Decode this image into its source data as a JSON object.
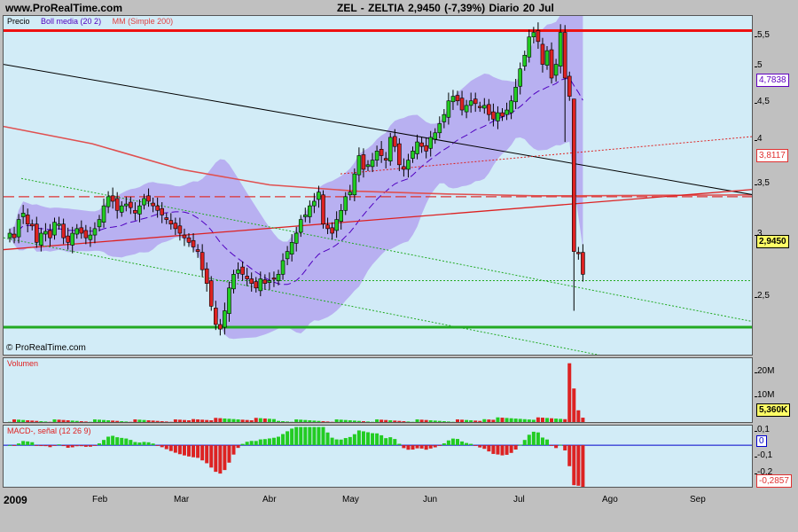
{
  "header": {
    "site": "www.ProRealTime.com",
    "title": "ZEL - ZELTIA    2,9450 (-7,39%)    Diario  20 Jul"
  },
  "price_panel": {
    "legend": {
      "price": "Precio",
      "boll": "Boll media (20 2)",
      "mm": "MM (Simple 200)"
    },
    "copyright": "© ProRealTime.com",
    "ticks": [
      "5,5",
      "5",
      "4,5",
      "4",
      "3,5",
      "3",
      "2,5"
    ],
    "badges": {
      "boll": "4,7838",
      "mm": "3,8117",
      "last": "2,9450"
    }
  },
  "volume_panel": {
    "label": "Volumen",
    "ticks": [
      "20M",
      "10M"
    ],
    "badge": "5,360K"
  },
  "macd_panel": {
    "label": "MACD-, señal (12 26 9)",
    "ticks": [
      "0,1",
      "0",
      "-0,1",
      "-0,2"
    ],
    "badge": "-0,2857"
  },
  "xaxis": {
    "labels": [
      "2009",
      "Feb",
      "Mar",
      "Abr",
      "May",
      "Jun",
      "Jul",
      "Ago",
      "Sep"
    ]
  },
  "colors": {
    "up": "#22cc22",
    "down": "#dd2222",
    "boll_band": "#b4a6f0",
    "boll_mid": "#5000c0",
    "mm200": "#e05050"
  },
  "chart_data": {
    "type": "candlestick",
    "title": "ZEL - ZELTIA",
    "price_ylim": [
      2.05,
      5.78
    ],
    "closes": [
      3.4,
      3.35,
      3.55,
      3.62,
      3.5,
      3.48,
      3.3,
      3.4,
      3.42,
      3.35,
      3.52,
      3.5,
      3.35,
      3.3,
      3.4,
      3.45,
      3.4,
      3.35,
      3.38,
      3.45,
      3.55,
      3.7,
      3.8,
      3.75,
      3.65,
      3.7,
      3.72,
      3.68,
      3.62,
      3.7,
      3.78,
      3.75,
      3.7,
      3.65,
      3.6,
      3.55,
      3.5,
      3.45,
      3.4,
      3.35,
      3.3,
      3.25,
      3.2,
      3.0,
      2.85,
      2.6,
      2.4,
      2.35,
      2.55,
      2.8,
      2.95,
      3.0,
      2.95,
      2.9,
      2.85,
      2.8,
      2.9,
      2.85,
      2.88,
      2.9,
      2.95,
      3.1,
      3.2,
      3.3,
      3.4,
      3.55,
      3.6,
      3.7,
      3.75,
      3.85,
      3.5,
      3.45,
      3.4,
      3.55,
      3.65,
      3.8,
      3.85,
      4.05,
      4.25,
      4.1,
      4.15,
      4.2,
      4.3,
      4.25,
      4.2,
      4.45,
      4.35,
      4.15,
      4.1,
      4.2,
      4.3,
      4.4,
      4.35,
      4.3,
      4.45,
      4.5,
      4.6,
      4.7,
      4.85,
      4.9,
      4.85,
      4.75,
      4.8,
      4.85,
      4.82,
      4.78,
      4.8,
      4.7,
      4.65,
      4.72,
      4.68,
      4.75,
      4.85,
      5.0,
      5.2,
      5.35,
      5.55,
      5.6,
      5.5,
      5.25,
      5.4,
      5.1,
      5.25,
      5.6,
      5.1,
      4.9,
      3.2,
      3.18,
      2.95
    ],
    "bollinger": {
      "period": 20,
      "stddev": 2,
      "last_mid": 4.7838
    },
    "mm200": {
      "period": 200,
      "last": 3.8117
    },
    "horizontal_lines": [
      5.62,
      2.37,
      3.8,
      2.88
    ],
    "volume": {
      "ylim": [
        0,
        26
      ],
      "unit": "M",
      "last": "5,360K",
      "spikes": [
        [
          125,
          24
        ],
        [
          126,
          14
        ],
        [
          127,
          5.36
        ]
      ]
    },
    "macd": {
      "ylim": [
        -0.31,
        0.14
      ],
      "last": -0.2857
    },
    "x_labels": [
      "2009",
      "Feb",
      "Mar",
      "Abr",
      "May",
      "Jun",
      "Jul",
      "Ago",
      "Sep"
    ]
  }
}
